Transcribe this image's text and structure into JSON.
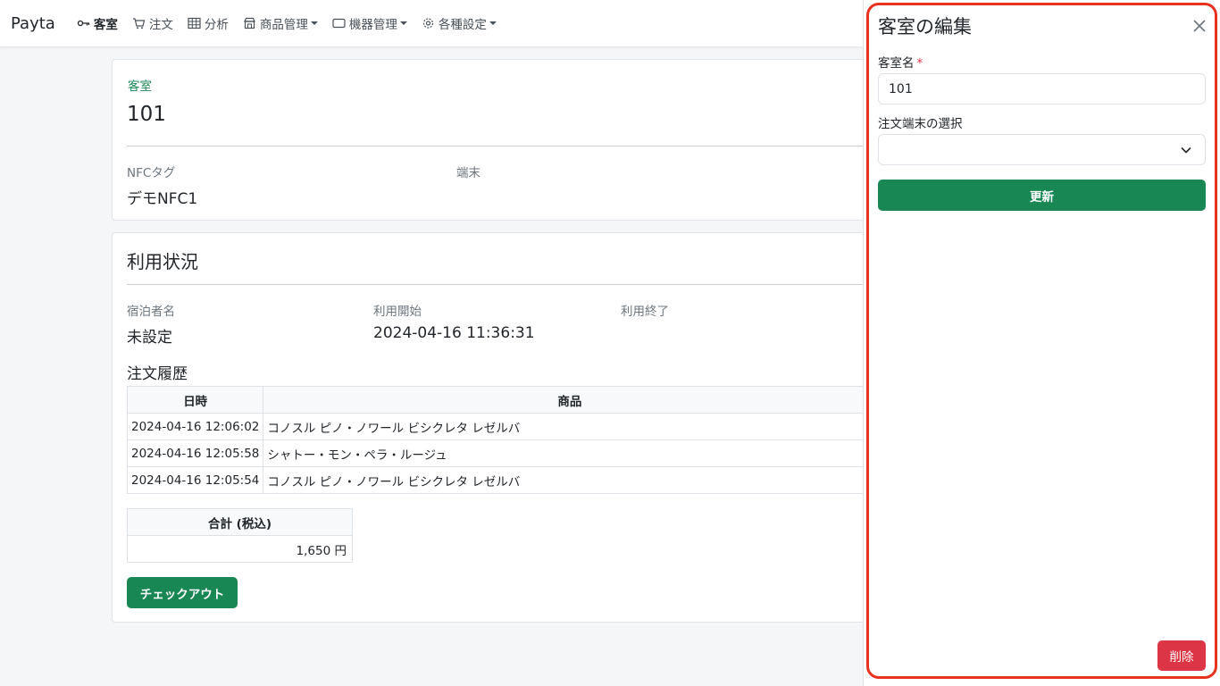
{
  "navbar": {
    "brand": "Payta",
    "items": [
      {
        "label": "客室",
        "icon": "key-icon",
        "active": true
      },
      {
        "label": "注文",
        "icon": "cart-icon"
      },
      {
        "label": "分析",
        "icon": "table-icon"
      },
      {
        "label": "商品管理",
        "icon": "shop-icon",
        "dropdown": true
      },
      {
        "label": "機器管理",
        "icon": "tablet-icon",
        "dropdown": true
      },
      {
        "label": "各種設定",
        "icon": "gear-icon",
        "dropdown": true
      }
    ]
  },
  "room_card": {
    "section_label": "客室",
    "room_number": "101",
    "nfc_label": "NFCタグ",
    "nfc_value": "デモNFC1",
    "terminal_label": "端末",
    "terminal_value": ""
  },
  "usage": {
    "title": "利用状況",
    "guest_label": "宿泊者名",
    "guest_value": "未設定",
    "start_label": "利用開始",
    "start_value": "2024-04-16 11:36:31",
    "end_label": "利用終了",
    "end_value": "",
    "history_title": "注文履歴",
    "columns": [
      "日時",
      "商品"
    ],
    "orders": [
      {
        "datetime": "2024-04-16 12:06:02",
        "product": "コノスル ピノ・ノワール ビシクレタ レゼルバ"
      },
      {
        "datetime": "2024-04-16 12:05:58",
        "product": "シャトー・モン・ペラ・ルージュ"
      },
      {
        "datetime": "2024-04-16 12:05:54",
        "product": "コノスル ピノ・ノワール ビシクレタ レゼルバ"
      }
    ],
    "total_label": "合計 (税込)",
    "total_value": "1,650 円",
    "checkout_label": "チェックアウト"
  },
  "edit_panel": {
    "title": "客室の編集",
    "name_label": "客室名",
    "required_mark": "*",
    "name_value": "101",
    "terminal_label": "注文端末の選択",
    "terminal_selected": "",
    "update_label": "更新",
    "delete_label": "削除",
    "highlight_color": "#e8321e"
  },
  "colors": {
    "primary": "#198754",
    "danger": "#dc3545"
  }
}
